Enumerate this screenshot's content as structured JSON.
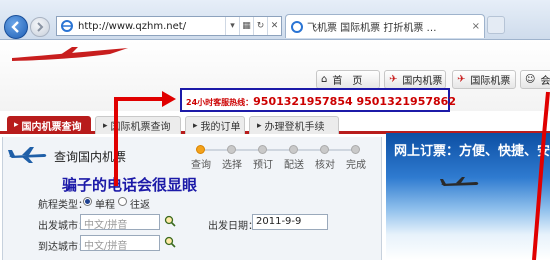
{
  "browser": {
    "url": "http://www.qzhm.net/",
    "tab_title": "飞机票 国际机票 打折机票 …",
    "tab_close": "×"
  },
  "header": {
    "nav": {
      "home": "首　页",
      "domestic": "国内机票",
      "international": "国际机票",
      "member": "会员"
    },
    "hotline": {
      "label": "24小时客服热线：",
      "numbers": "9501321957854  9501321957862"
    }
  },
  "tabs": {
    "domestic_search": "国内机票查询",
    "international_search": "国际机票查询",
    "my_orders": "我的订单",
    "boarding": "办理登机手续"
  },
  "search": {
    "title": "查询国内机票",
    "steps": [
      "查询",
      "选择",
      "预订",
      "配送",
      "核对",
      "完成"
    ],
    "trip_type_label": "航程类型：",
    "one_way": "单程",
    "round_trip": "往返",
    "from_label": "出发城市：",
    "from_placeholder": "中文/拼音",
    "date_label": "出发日期：",
    "date_value": "2011-9-9",
    "to_label": "到达城市：",
    "to_placeholder": "中文/拼音"
  },
  "annotation": "骗子的电话会很显眼",
  "banner": {
    "text": "网上订票：方便、快捷、安"
  },
  "colors": {
    "brand_red": "#b81c1c",
    "annotation_blue": "#1c1aa8",
    "arrow_red": "#e00000"
  }
}
